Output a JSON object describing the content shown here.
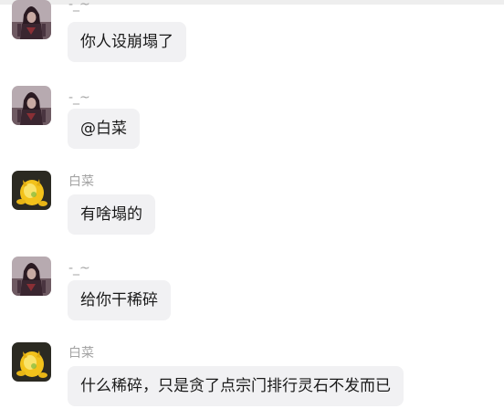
{
  "colors": {
    "background": "#ffffff",
    "bubble": "#f1f1f3",
    "sender_text": "#a4a4a4",
    "message_text": "#1a1a1a"
  },
  "messages": [
    {
      "sender": "-_~",
      "text": "你人设崩塌了",
      "avatar": "dark-warrior-avatar"
    },
    {
      "sender": "-_~",
      "text": "@白菜",
      "avatar": "dark-warrior-avatar"
    },
    {
      "sender": "白菜",
      "text": "有啥塌的",
      "avatar": "yellow-creature-avatar"
    },
    {
      "sender": "-_~",
      "text": "给你干稀碎",
      "avatar": "dark-warrior-avatar"
    },
    {
      "sender": "白菜",
      "text": "什么稀碎，只是贪了点宗门排行灵石不发而已",
      "avatar": "yellow-creature-avatar"
    }
  ]
}
